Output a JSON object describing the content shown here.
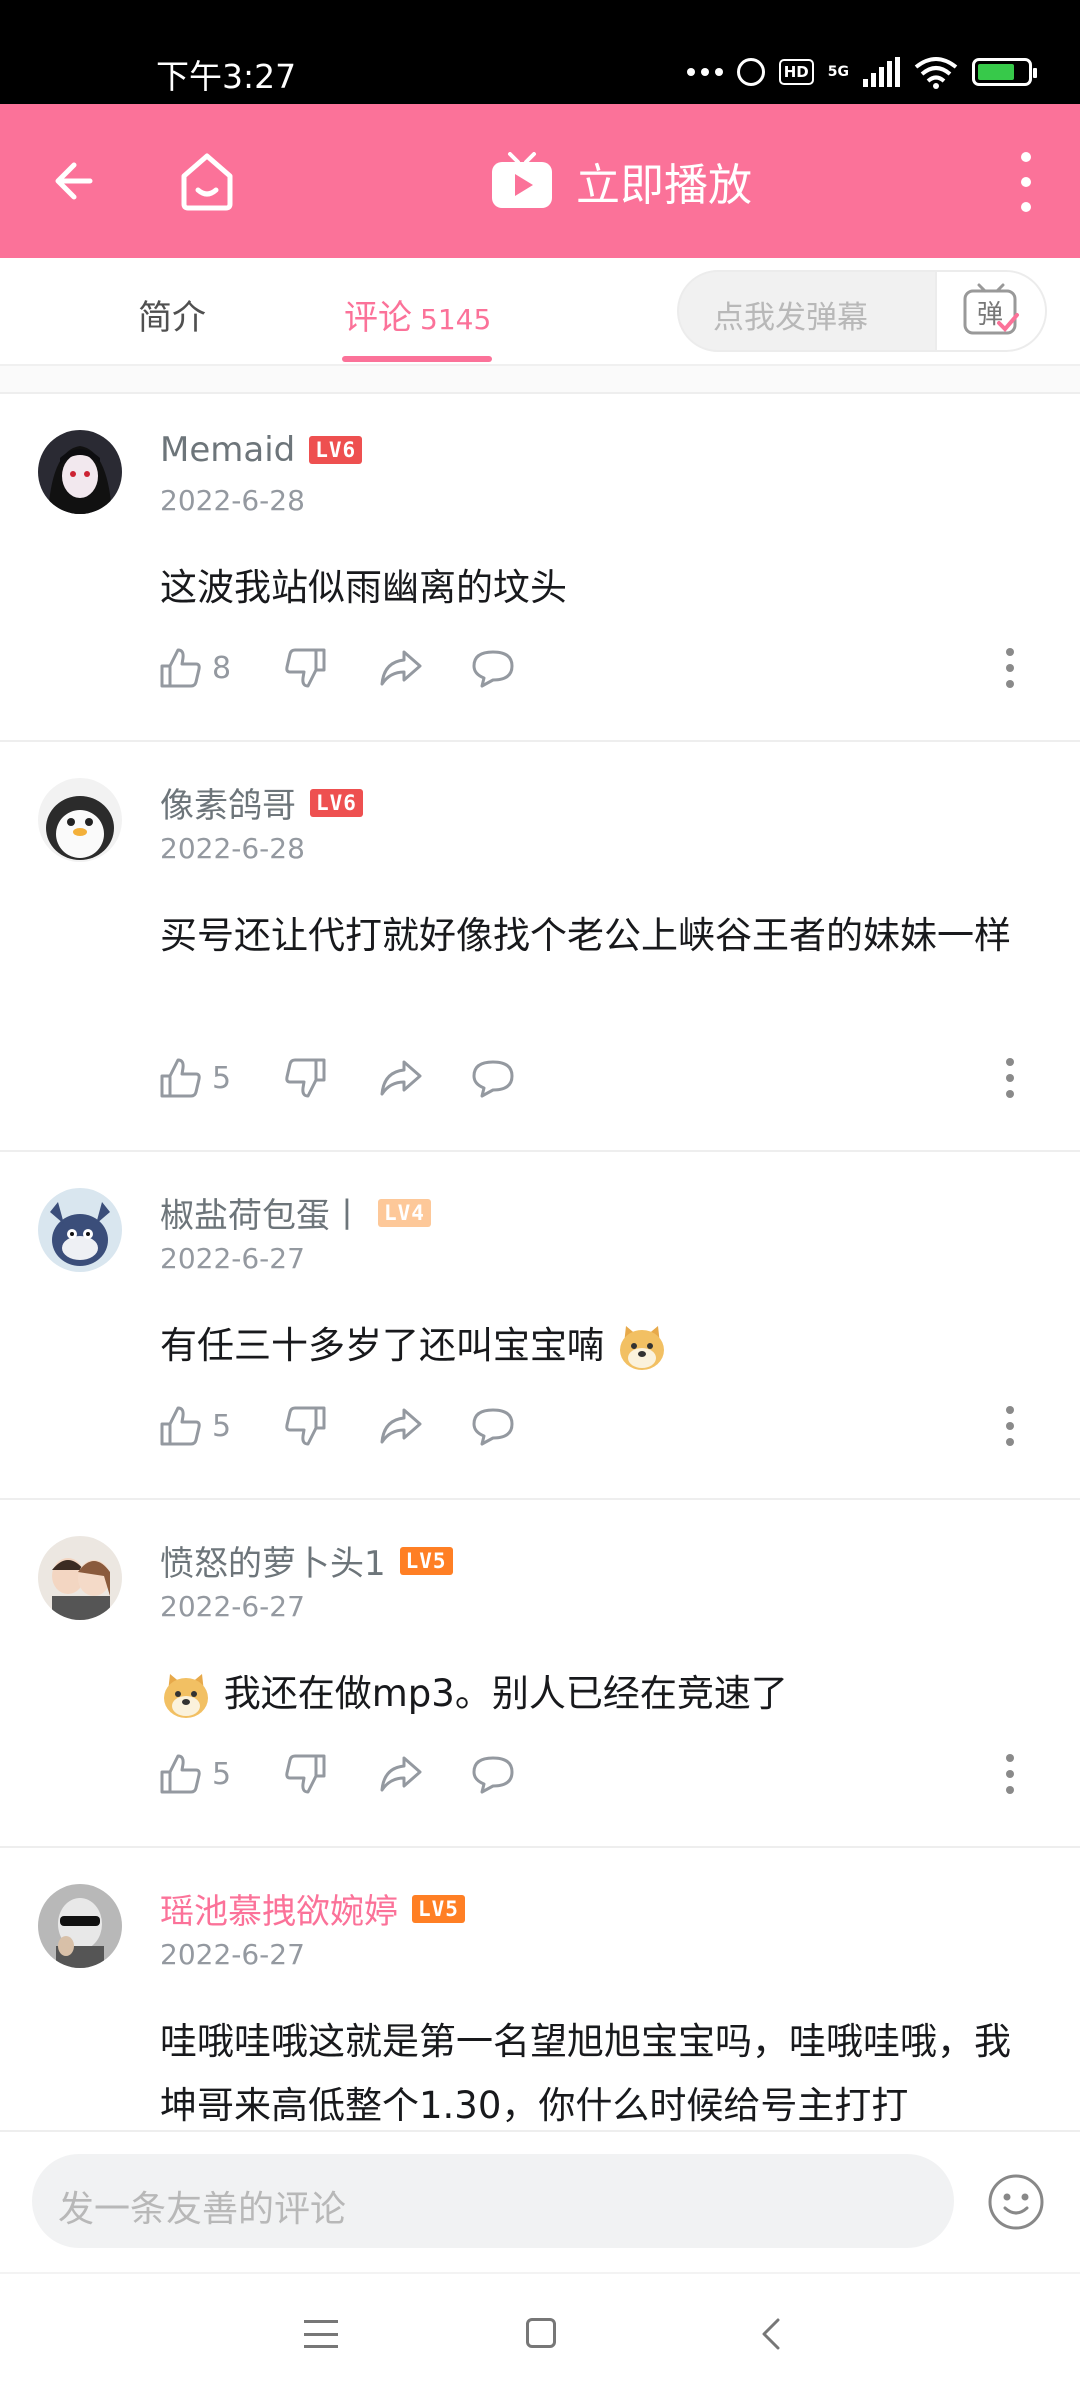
{
  "status_bar": {
    "time": "下午3:27",
    "network": "5G",
    "hd": "HD"
  },
  "top_bar": {
    "play_label": "立即播放"
  },
  "tabs": {
    "intro": "简介",
    "comments": "评论",
    "comments_count": "5145",
    "danmaku_placeholder": "点我发弹幕",
    "danmaku_button": "弹"
  },
  "comments": [
    {
      "username": "Memaid",
      "level": "LV6",
      "date": "2022-6-28",
      "text": "这波我站似雨幽离的坟头",
      "likes": "8"
    },
    {
      "username": "像素鸽哥",
      "level": "LV6",
      "date": "2022-6-28",
      "text": "买号还让代打就好像找个老公上峡谷王者的妹妹一样",
      "likes": "5"
    },
    {
      "username": "椒盐荷包蛋丨",
      "level": "LV4",
      "date": "2022-6-27",
      "text": "有任三十多岁了还叫宝宝喃",
      "likes": "5"
    },
    {
      "username": "愤怒的萝卜头1",
      "level": "LV5",
      "date": "2022-6-27",
      "text": "我还在做mp3。别人已经在竞速了",
      "likes": "5"
    },
    {
      "username": "瑶池慕拽欲婉婷",
      "level": "LV5",
      "date": "2022-6-27",
      "text": "哇哦哇哦这就是第一名望旭旭宝宝吗，哇哦哇哦，我坤哥来高低整个1.30，你什么时候给号主打打"
    }
  ],
  "comment_input": {
    "placeholder": "发一条友善的评论"
  },
  "colors": {
    "accent": "#fb7299",
    "lv6": "#ee5050",
    "lv5": "#ff7f24",
    "lv4": "#fdc899"
  },
  "icons": [
    "back-arrow-icon",
    "home-icon",
    "tv-play-icon",
    "more-vertical-icon",
    "thumbs-up-icon",
    "thumbs-down-icon",
    "share-icon",
    "reply-icon",
    "emoji-icon"
  ]
}
